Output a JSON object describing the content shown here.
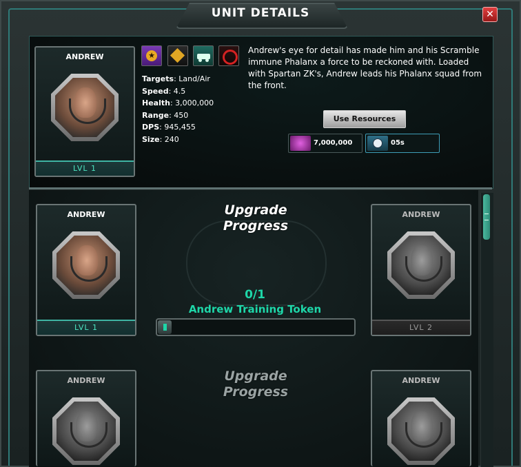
{
  "window": {
    "title": "UNIT DETAILS",
    "close_label": "✕"
  },
  "unit": {
    "name": "ANDREW",
    "level": "LVL 1",
    "stats": [
      {
        "key": "Targets",
        "value": "Land/Air"
      },
      {
        "key": "Speed",
        "value": "4.5"
      },
      {
        "key": "Health",
        "value": "3,000,000"
      },
      {
        "key": "Range",
        "value": "450"
      },
      {
        "key": "DPS",
        "value": "945,455"
      },
      {
        "key": "Size",
        "value": "240"
      }
    ],
    "description": "Andrew's eye for detail has made him and his Scramble immune Phalanx a force to be reckoned with. Loaded with Spartan ZK's, Andrew leads his Phalanx squad from the front.",
    "type_icons": [
      {
        "name": "star-rank-icon",
        "color": "#6a2fa0"
      },
      {
        "name": "diamond-arrow-icon",
        "color": "#d89a1c"
      },
      {
        "name": "vehicle-icon",
        "color": "#2aa890"
      },
      {
        "name": "scramble-icon",
        "color": "#c22020"
      }
    ]
  },
  "actions": {
    "use_resources_label": "Use Resources",
    "resource_cost": "7,000,000",
    "time_cost": "05s"
  },
  "upgrades": [
    {
      "title_line1": "Upgrade",
      "title_line2": "Progress",
      "from_name": "ANDREW",
      "from_level": "LVL 1",
      "to_name": "ANDREW",
      "to_level": "LVL 2",
      "count": "0/1",
      "token_label": "Andrew Training Token",
      "progress": 0
    },
    {
      "title_line1": "Upgrade",
      "title_line2": "Progress",
      "from_name": "ANDREW",
      "to_name": "ANDREW"
    }
  ]
}
